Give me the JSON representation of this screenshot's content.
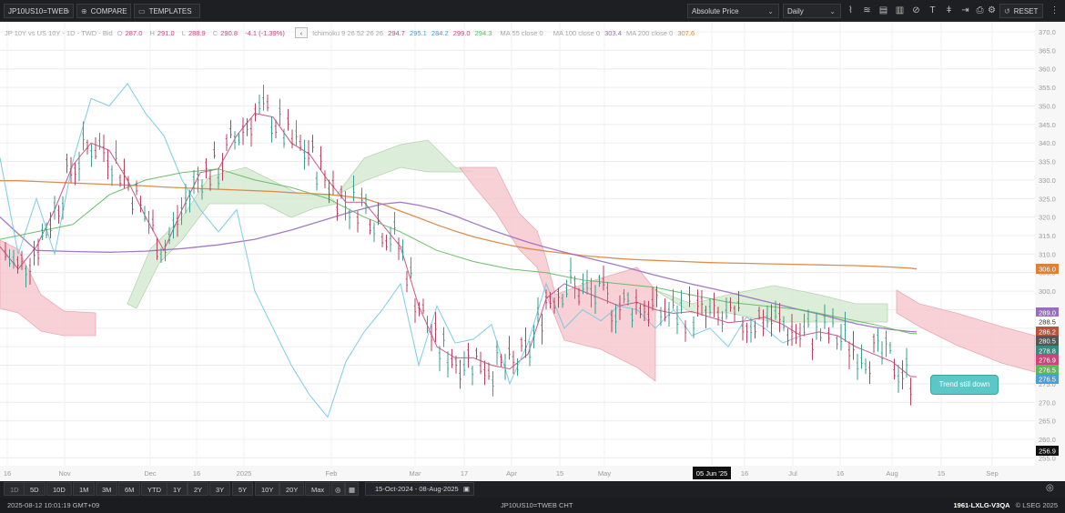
{
  "toolbar": {
    "symbol": "JP10US10=TWEB",
    "compare": "COMPARE",
    "templates": "TEMPLATES",
    "price_type": "Absolute Price",
    "interval": "Daily",
    "reset": "RESET"
  },
  "legend": {
    "series_desc": "JP 10Y vs US 10Y - 1D - TWD - Bid",
    "o_label": "O",
    "o_value": "287.0",
    "h_label": "H",
    "h_value": "291.0",
    "l_label": "L",
    "l_value": "288.9",
    "c_label": "C",
    "c_value": "290.8",
    "change": "-4.1 (-1.39%)",
    "ichimoku_label": "Ichimoku 9 26 52 26 26",
    "ichimoku_values": [
      "294.7",
      "295.1",
      "284.2",
      "299.0",
      "294.3"
    ],
    "ma55_label": "MA 55 close 0",
    "ma100_label": "MA 100 close 0",
    "ma100_value": "303.4",
    "ma200_label": "MA 200 close 0",
    "ma200_value": "307.6",
    "colors": {
      "conversion": "#c8467a",
      "base": "#6ec6e6",
      "lagging": "#5cb85c",
      "spanA": "#c8467a",
      "spanB": "#e0a060",
      "ma100": "#9a6cc0",
      "ma200": "#d9823b"
    }
  },
  "annotation": {
    "text": "Trend still down"
  },
  "bottom": {
    "ranges": [
      "1D",
      "5D",
      "10D",
      "1M",
      "3M",
      "6M",
      "YTD",
      "1Y",
      "2Y",
      "3Y",
      "5Y",
      "10Y",
      "20Y",
      "Max"
    ],
    "date_range": "15-Oct-2024  -  08-Aug-2025"
  },
  "status": {
    "datetime": "2025-08-12 10:01:19 GMT+09",
    "ric": "JP10US10=TWEB CHT",
    "code": "1961-LXLG-V3QA",
    "copyright": "© LSEG 2025"
  },
  "chart_data": {
    "type": "candlestick",
    "y_axis": {
      "min": 250,
      "max": 372,
      "ticks": [
        255,
        260,
        265,
        270,
        275,
        280,
        285,
        290,
        295,
        300,
        305,
        310,
        315,
        320,
        325,
        330,
        335,
        340,
        345,
        350,
        355,
        360,
        365,
        370
      ],
      "tick_labels": [
        "255.0",
        "260.0",
        "265.0",
        "270.0",
        "275.0",
        "280.0",
        "285.0",
        "290.0",
        "295.0",
        "300.0",
        "305.0",
        "310.0",
        "315.0",
        "320.0",
        "325.0",
        "330.0",
        "335.0",
        "340.0",
        "345.0",
        "350.0",
        "355.0",
        "360.0",
        "365.0",
        "370.0"
      ]
    },
    "x_axis": {
      "labels": [
        "16",
        "Nov",
        "Dec",
        "16",
        "2025",
        "Feb",
        "Mar",
        "17",
        "Apr",
        "15",
        "May",
        "05 Jun '25",
        "16",
        "Jul",
        "16",
        "Aug",
        "15",
        "Sep"
      ],
      "highlight": "05 Jun '25"
    },
    "price_badges": [
      {
        "value": "306.0",
        "color": "#d9823b"
      },
      {
        "value": "289.0",
        "color": "#9a6cc0"
      },
      {
        "value": "288.5",
        "color": "#ffffff"
      },
      {
        "value": "286.2",
        "color": "#b5553d"
      },
      {
        "value": "280.5",
        "color": "#555555"
      },
      {
        "value": "278.8",
        "color": "#35897f"
      },
      {
        "value": "276.9",
        "color": "#c8467a"
      },
      {
        "value": "276.5",
        "color": "#5cb85c"
      },
      {
        "value": "276.5",
        "color": "#4a9fd4"
      },
      {
        "value": "256.9",
        "color": "#111111"
      }
    ],
    "series": [
      {
        "name": "MA 200",
        "color": "#d9823b",
        "x": [
          0,
          20,
          40,
          60,
          80,
          100,
          120,
          140,
          160,
          180,
          200,
          220,
          240,
          260,
          280,
          300,
          320,
          340,
          360,
          380,
          400,
          420,
          440,
          460,
          480,
          500,
          520,
          540,
          560,
          580,
          600,
          620,
          640,
          660,
          680,
          700,
          720,
          740,
          760,
          780,
          800,
          820,
          840,
          860,
          880,
          900,
          920,
          940,
          960,
          980,
          1000,
          1007
        ],
        "values": [
          329.8,
          329.8,
          329.6,
          329.4,
          329.2,
          329.0,
          328.8,
          328.6,
          328.4,
          328.1,
          327.9,
          327.7,
          327.5,
          327.3,
          327.1,
          326.9,
          326.6,
          326.4,
          326.1,
          325.6,
          325.0,
          323.5,
          321.6,
          319.8,
          317.9,
          316.2,
          314.7,
          313.5,
          312.4,
          311.5,
          310.8,
          310.2,
          309.6,
          309.2,
          308.8,
          308.5,
          308.3,
          308.1,
          307.9,
          307.7,
          307.6,
          307.5,
          307.4,
          307.3,
          307.2,
          307.1,
          307.0,
          306.9,
          306.7,
          306.5,
          306.2,
          306.0
        ]
      },
      {
        "name": "MA 100",
        "color": "#9a6cc0",
        "x": [
          0,
          40,
          80,
          120,
          160,
          200,
          240,
          280,
          320,
          360,
          380,
          400,
          420,
          440,
          460,
          480,
          500,
          520,
          540,
          560,
          580,
          600,
          620,
          640,
          660,
          680,
          700,
          720,
          740,
          760,
          780,
          800,
          820,
          840,
          860,
          880,
          900,
          920,
          940,
          960,
          980,
          1000,
          1007
        ],
        "values": [
          320.0,
          311.0,
          310.7,
          310.5,
          310.8,
          311.5,
          312.5,
          314.0,
          316.5,
          319.5,
          321.0,
          322.3,
          323.5,
          324.0,
          323.2,
          322.0,
          320.3,
          318.4,
          316.5,
          314.8,
          313.2,
          311.8,
          310.5,
          309.3,
          308.1,
          306.9,
          305.6,
          304.3,
          303.1,
          301.9,
          300.8,
          299.7,
          298.5,
          297.3,
          296.1,
          294.9,
          293.8,
          292.5,
          291.2,
          290.3,
          289.6,
          289.1,
          289.0
        ]
      },
      {
        "name": "Conversion",
        "color": "#c8467a",
        "x": [
          0,
          20,
          40,
          60,
          80,
          100,
          120,
          140,
          160,
          180,
          200,
          220,
          240,
          260,
          280,
          300,
          320,
          340,
          360,
          380,
          400,
          420,
          440,
          460,
          480,
          500,
          520,
          540,
          560,
          580,
          600,
          620,
          640,
          660,
          680,
          700,
          720,
          740,
          760,
          780,
          800,
          820,
          840,
          860,
          880,
          900,
          920,
          940,
          960,
          980,
          1000,
          1007
        ],
        "values": [
          312.0,
          306.0,
          312.0,
          322.0,
          334.0,
          340.0,
          338.0,
          330.0,
          320.0,
          311.0,
          322.0,
          332.0,
          333.0,
          342.0,
          348.0,
          347.0,
          340.0,
          337.0,
          330.0,
          324.0,
          324.0,
          318.0,
          312.0,
          296.0,
          285.0,
          282.0,
          282.0,
          280.0,
          279.0,
          283.0,
          298.0,
          302.0,
          300.0,
          298.0,
          296.0,
          297.0,
          295.0,
          294.0,
          294.5,
          293.0,
          291.5,
          292.0,
          293.0,
          291.0,
          288.0,
          289.0,
          288.0,
          285.0,
          283.0,
          281.0,
          277.0,
          276.9
        ]
      },
      {
        "name": "Base",
        "color": "#6ec6e6",
        "x": [
          0,
          20,
          40,
          60,
          80,
          100,
          120,
          140,
          160,
          180,
          200,
          220,
          240,
          260,
          280,
          300,
          320,
          340,
          360,
          380,
          400,
          420,
          440,
          460,
          480,
          500,
          520,
          540,
          560,
          580,
          600,
          620,
          640,
          660,
          680,
          700,
          720,
          740,
          760,
          780,
          800,
          820,
          840,
          860,
          880
        ],
        "values": [
          336.0,
          310.0,
          325.0,
          310.0,
          335.0,
          352.0,
          350.0,
          356.0,
          348.0,
          342.0,
          330.0,
          322.0,
          316.0,
          322.0,
          300.0,
          290.0,
          280.0,
          272.0,
          266.0,
          281.0,
          289.0,
          295.0,
          302.0,
          280.0,
          296.0,
          286.0,
          287.0,
          291.0,
          275.0,
          286.0,
          302.0,
          290.0,
          295.0,
          292.0,
          296.0,
          295.0,
          290.0,
          295.0,
          288.0,
          290.0,
          285.0,
          293.0,
          290.0,
          286.0,
          288.0
        ]
      },
      {
        "name": "Lagging",
        "color": "#5cb85c",
        "x": [
          0,
          40,
          80,
          120,
          160,
          200,
          240,
          280,
          320,
          360,
          400,
          440,
          480,
          520,
          560,
          600,
          640,
          680,
          720,
          760,
          800,
          840,
          880,
          920,
          960,
          1000,
          1007
        ],
        "values": [
          314.0,
          316.0,
          318.0,
          326.0,
          330.0,
          332.0,
          333.0,
          330.0,
          328.0,
          325.0,
          320.0,
          316.0,
          311.0,
          308.0,
          306.0,
          305.0,
          303.0,
          302.0,
          301.0,
          299.0,
          297.0,
          296.0,
          295.0,
          293.0,
          291.0,
          288.6,
          288.5
        ]
      }
    ],
    "annotations": [
      "Trend still down"
    ]
  }
}
